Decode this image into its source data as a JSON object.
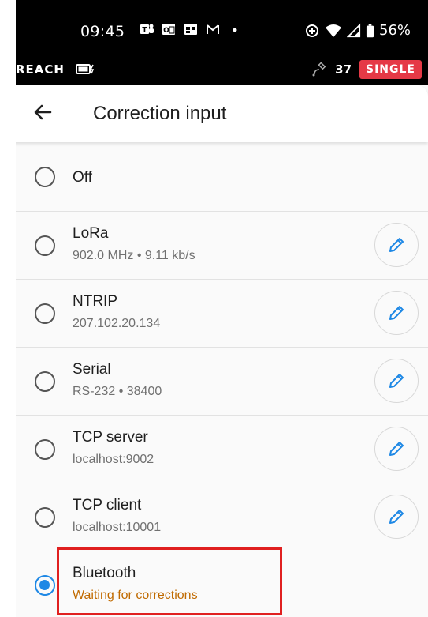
{
  "status_bar": {
    "time": "09:45",
    "notification_icons": [
      "teams-icon",
      "outlook-icon",
      "calendar-icon",
      "gmail-icon",
      "dot-icon"
    ],
    "battery_percent": "56%"
  },
  "app_bar": {
    "device_name": "REACH",
    "satellite_count": "37",
    "solution_mode": "SINGLE",
    "mode_color": "#e53946"
  },
  "header": {
    "title": "Correction input"
  },
  "options": [
    {
      "label": "Off",
      "detail": "",
      "selected": false,
      "editable": false
    },
    {
      "label": "LoRa",
      "detail": "902.0 MHz • 9.11 kb/s",
      "selected": false,
      "editable": true
    },
    {
      "label": "NTRIP",
      "detail": "207.102.20.134",
      "selected": false,
      "editable": true
    },
    {
      "label": "Serial",
      "detail": "RS-232 • 38400",
      "selected": false,
      "editable": true
    },
    {
      "label": "TCP server",
      "detail": "localhost:9002",
      "selected": false,
      "editable": true
    },
    {
      "label": "TCP client",
      "detail": "localhost:10001",
      "selected": false,
      "editable": true
    },
    {
      "label": "Bluetooth",
      "detail": "Waiting for corrections",
      "selected": true,
      "editable": false
    }
  ],
  "colors": {
    "accent": "#1e88e5",
    "waiting_text": "#c06a00",
    "highlight_box": "#e02020"
  }
}
